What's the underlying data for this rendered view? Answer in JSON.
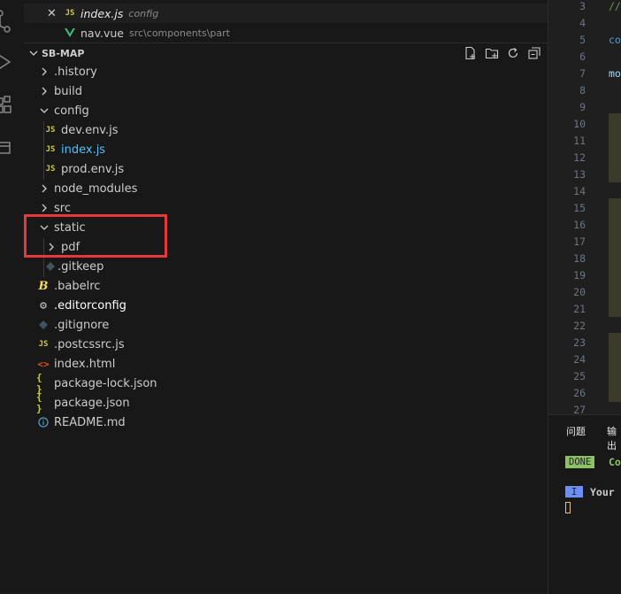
{
  "open_editors": [
    {
      "name": "index.js",
      "folder": "config",
      "icon": "js-icon",
      "active": true
    },
    {
      "name": "nav.vue",
      "folder": "src\\components\\part",
      "icon": "vue-icon",
      "active": false
    }
  ],
  "explorer": {
    "root_title": "SB-MAP",
    "actions": [
      "new-file-icon",
      "new-folder-icon",
      "refresh-icon",
      "collapse-all-icon"
    ],
    "items": [
      {
        "label": ".history",
        "type": "folder",
        "expanded": false,
        "depth": 0
      },
      {
        "label": "build",
        "type": "folder",
        "expanded": false,
        "depth": 0
      },
      {
        "label": "config",
        "type": "folder",
        "expanded": true,
        "depth": 0
      },
      {
        "label": "dev.env.js",
        "type": "js",
        "depth": 1
      },
      {
        "label": "index.js",
        "type": "js",
        "depth": 1,
        "selected": true
      },
      {
        "label": "prod.env.js",
        "type": "js",
        "depth": 1
      },
      {
        "label": "node_modules",
        "type": "folder",
        "expanded": false,
        "depth": 0
      },
      {
        "label": "src",
        "type": "folder",
        "expanded": false,
        "depth": 0
      },
      {
        "label": "static",
        "type": "folder",
        "expanded": true,
        "depth": 0
      },
      {
        "label": "pdf",
        "type": "folder",
        "expanded": false,
        "depth": 1
      },
      {
        "label": ".gitkeep",
        "type": "git",
        "depth": 1
      },
      {
        "label": ".babelrc",
        "type": "babel",
        "depth": 0
      },
      {
        "label": ".editorconfig",
        "type": "gear",
        "depth": 0
      },
      {
        "label": ".gitignore",
        "type": "git",
        "depth": 0
      },
      {
        "label": ".postcssrc.js",
        "type": "js",
        "depth": 0
      },
      {
        "label": "index.html",
        "type": "html",
        "depth": 0
      },
      {
        "label": "package-lock.json",
        "type": "json",
        "depth": 0
      },
      {
        "label": "package.json",
        "type": "json",
        "depth": 0
      },
      {
        "label": "README.md",
        "type": "info",
        "depth": 0
      }
    ]
  },
  "file_badges": {
    "js": "JS",
    "json": "{ }"
  },
  "editor": {
    "line_numbers": [
      "3",
      "4",
      "5",
      "6",
      "7",
      "8",
      "9",
      "10",
      "11",
      "12",
      "13",
      "14",
      "15",
      "16",
      "17",
      "18",
      "19",
      "20",
      "21",
      "22",
      "23",
      "24",
      "25",
      "26",
      "27"
    ],
    "code_fragments": [
      {
        "line": "3",
        "text": "//"
      },
      {
        "line": "5",
        "text": "co"
      },
      {
        "line": "7",
        "text": "mo"
      }
    ]
  },
  "panel": {
    "tabs": [
      "问题",
      "输出"
    ],
    "done_badge": "DONE",
    "done_text": "Co",
    "info_badge": "I",
    "info_text": "Your"
  },
  "colors": {
    "js": "#cbcb41",
    "vue": "#41b883",
    "html": "#e44d26",
    "json": "#cbcb41",
    "info": "#519aba",
    "git": "#41535b",
    "babel": "#f5da55",
    "highlight_box": "#e5383b",
    "selected_text": "#4fc1ff"
  }
}
